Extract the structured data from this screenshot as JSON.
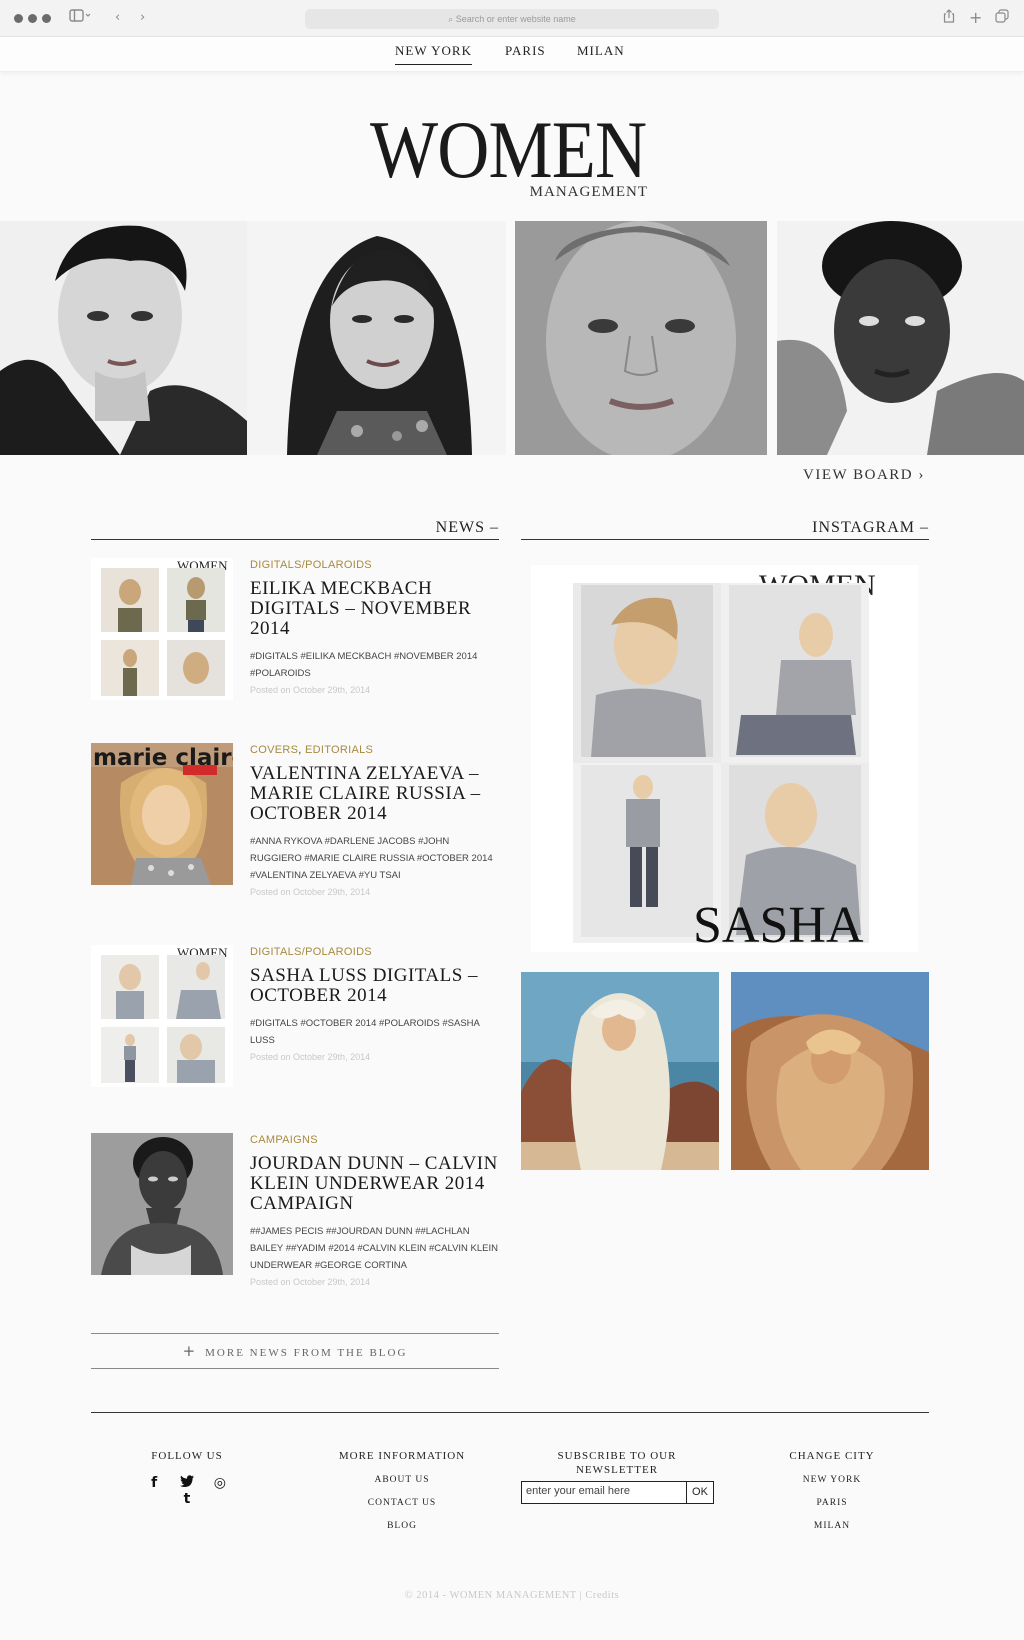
{
  "browser": {
    "url_placeholder": "Search or enter website name"
  },
  "nav": {
    "cities": [
      "NEW YORK",
      "PARIS",
      "MILAN"
    ]
  },
  "logo": {
    "main": "WOMEN",
    "sub": "MANAGEMENT"
  },
  "hero": {
    "view_board": "VIEW BOARD ›"
  },
  "sections": {
    "news": "NEWS",
    "instagram": "INSTAGRAM",
    "dash": "–"
  },
  "news": [
    {
      "categories": [
        "DIGITALS/POLAROIDS"
      ],
      "title": "EILIKA MECKBACH DIGITALS – NOVEMBER 2014",
      "tags": "#DIGITALS #EILIKA MECKBACH #NOVEMBER 2014 #POLAROIDS",
      "posted": "Posted on October 29th, 2014"
    },
    {
      "categories": [
        "COVERS",
        "EDITORIALS"
      ],
      "title": "VALENTINA ZELYAEVA – MARIE CLAIRE RUSSIA – OCTOBER 2014",
      "tags": "#ANNA RYKOVA #DARLENE JACOBS #JOHN RUGGIERO #MARIE CLAIRE RUSSIA #OCTOBER 2014 #VALENTINA ZELYAEVA #YU TSAI",
      "posted": "Posted on October 29th, 2014"
    },
    {
      "categories": [
        "DIGITALS/POLAROIDS"
      ],
      "title": "SASHA LUSS DIGITALS – OCTOBER 2014",
      "tags": "#DIGITALS #OCTOBER 2014 #POLAROIDS #SASHA LUSS",
      "posted": "Posted on October 29th, 2014"
    },
    {
      "categories": [
        "CAMPAIGNS"
      ],
      "title": "JOURDAN DUNN – CALVIN KLEIN UNDERWEAR 2014 CAMPAIGN",
      "tags": "##JAMES PECIS ##JOURDAN DUNN ##LACHLAN BAILEY ##YADIM #2014 #CALVIN KLEIN #CALVIN KLEIN UNDERWEAR #GEORGE CORTINA",
      "posted": "Posted on October 29th, 2014"
    }
  ],
  "more_news": {
    "plus": "+",
    "label": "MORE NEWS FROM THE BLOG"
  },
  "thumb_text": {
    "women": "WOMEN",
    "marie_claire": "marie claire",
    "sasha": "SASHA"
  },
  "footer": {
    "follow_us": "FOLLOW US",
    "social": [
      "f",
      "t",
      "◎",
      "t"
    ],
    "more_info": {
      "title": "MORE INFORMATION",
      "links": [
        "ABOUT US",
        "CONTACT US",
        "BLOG"
      ]
    },
    "subscribe": {
      "title_line1": "SUBSCRIBE TO OUR",
      "title_line2": "NEWSLETTER",
      "input_value": "enter your email here",
      "ok": "OK"
    },
    "change_city": {
      "title": "CHANGE CITY",
      "links": [
        "NEW YORK",
        "PARIS",
        "MILAN"
      ]
    },
    "copyright": "© 2014 - WOMEN MANAGEMENT | Credits"
  }
}
